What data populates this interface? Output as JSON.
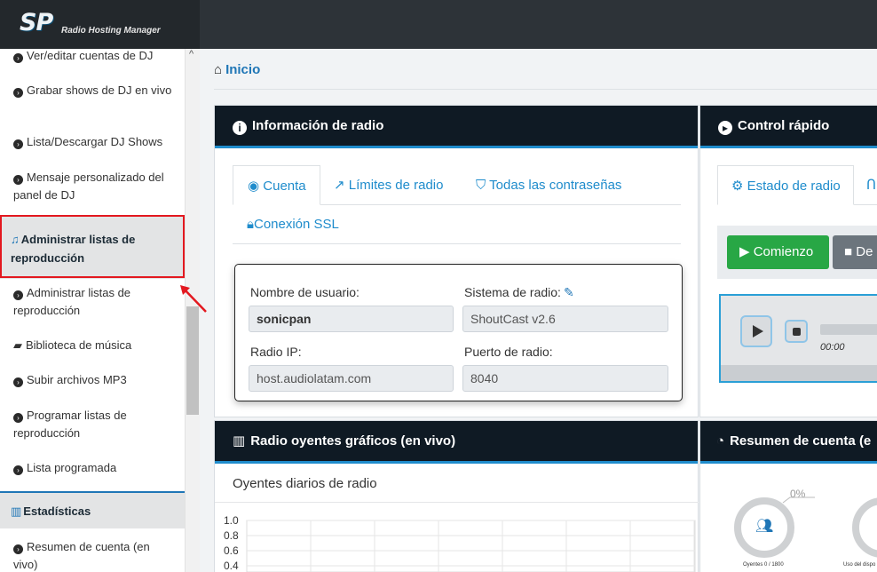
{
  "app": {
    "logo_mark": "SP",
    "logo_sub": "Radio Hosting Manager"
  },
  "sidebar": {
    "items": [
      {
        "label": "Ver/editar cuentas de DJ"
      },
      {
        "label": "Grabar shows de DJ en vivo"
      },
      {
        "label": "Lista/Descargar DJ Shows"
      },
      {
        "label": "Mensaje personalizado del panel de DJ"
      }
    ],
    "section_playlists": {
      "label": "Administrar listas de reproducción"
    },
    "playlist_items": [
      {
        "label": "Administrar listas de reproducción"
      },
      {
        "label": "Biblioteca de música"
      },
      {
        "label": "Subir archivos MP3"
      },
      {
        "label": "Programar listas de reproducción"
      },
      {
        "label": "Lista programada"
      }
    ],
    "section_stats": {
      "label": "Estadísticas"
    },
    "stats_items": [
      {
        "label": "Resumen de cuenta (en vivo)"
      }
    ]
  },
  "breadcrumb": {
    "home": "Inicio"
  },
  "radio_info": {
    "title": "Información de radio",
    "tabs": [
      "Cuenta",
      "Límites de radio",
      "Todas las contraseñas",
      "Conexión SSL"
    ],
    "username_label": "Nombre de usuario:",
    "username_value": "sonicpan",
    "system_label": "Sistema de radio:",
    "system_value": "ShoutCast v2.6",
    "ip_label": "Radio IP:",
    "ip_value": "host.audiolatam.com",
    "port_label": "Puerto de radio:",
    "port_value": "8040"
  },
  "quick_control": {
    "title": "Control rápido",
    "tab_status": "Estado de radio",
    "start_label": "Comienzo",
    "second_button_label": "De",
    "time": "00:00"
  },
  "listeners_chart": {
    "title": "Radio oyentes gráficos (en vivo)",
    "subtitle": "Oyentes diarios de radio"
  },
  "chart_data": {
    "type": "line",
    "title": "Oyentes diarios de radio",
    "y_ticks": [
      "1.0",
      "0.8",
      "0.6",
      "0.4"
    ],
    "ylim": [
      0,
      1.0
    ],
    "grid": true
  },
  "account_summary": {
    "title": "Resumen de cuenta (e",
    "percent": "0%",
    "donut1_label": "Oyentes 0 / 1800",
    "donut2_label": "Uso del dispo"
  },
  "colors": {
    "accent": "#1f76b6",
    "panel_header": "#0f1a24",
    "start_button": "#28a745",
    "highlight": "#e3181f"
  }
}
